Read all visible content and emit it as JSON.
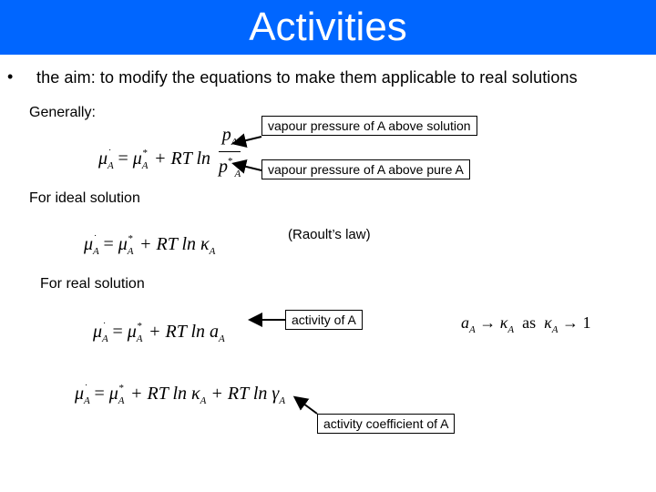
{
  "header": {
    "title": "Activities",
    "background_color": "#0066ff"
  },
  "bullet_glyph": "•",
  "aim_text": "the aim: to modify the equations to make them applicable to real solutions",
  "sections": {
    "generally": {
      "label": "Generally:",
      "equation": {
        "lhs": "μ",
        "sub": "A",
        "rhs_mu": "μ",
        "rhs_sup": "*",
        "rt_ln": "+ RT ln",
        "numerator": "p",
        "denominator": "p",
        "denominator_sup": "*"
      },
      "callouts": [
        "vapour pressure of A above solution",
        "vapour pressure of A above pure A"
      ]
    },
    "ideal": {
      "label": "For ideal solution",
      "equation": {
        "text_rt_ln": "+ RT ln",
        "variable": "κ"
      },
      "note": "(Raoult’s law)"
    },
    "real": {
      "label": "For real solution",
      "equation1": {
        "text_rt_ln": "+ RT ln",
        "variable": "a"
      },
      "callout1": "activity of A",
      "limit": {
        "a": "a",
        "arrow": "→",
        "kappa": "κ",
        "as": "as",
        "kappa2": "κ",
        "arrow2": "→",
        "one": "1"
      },
      "equation2": {
        "text_rt_ln1": "+ RT ln",
        "variable1": "κ",
        "text_rt_ln2": "+ RT ln",
        "variable2": "γ"
      },
      "callout2": "activity coefficient of A"
    }
  },
  "eq_symbols": {
    "mu": "μ",
    "sub_a": "A",
    "star": "*",
    "equals": "=",
    "dash_sup": "˙"
  }
}
